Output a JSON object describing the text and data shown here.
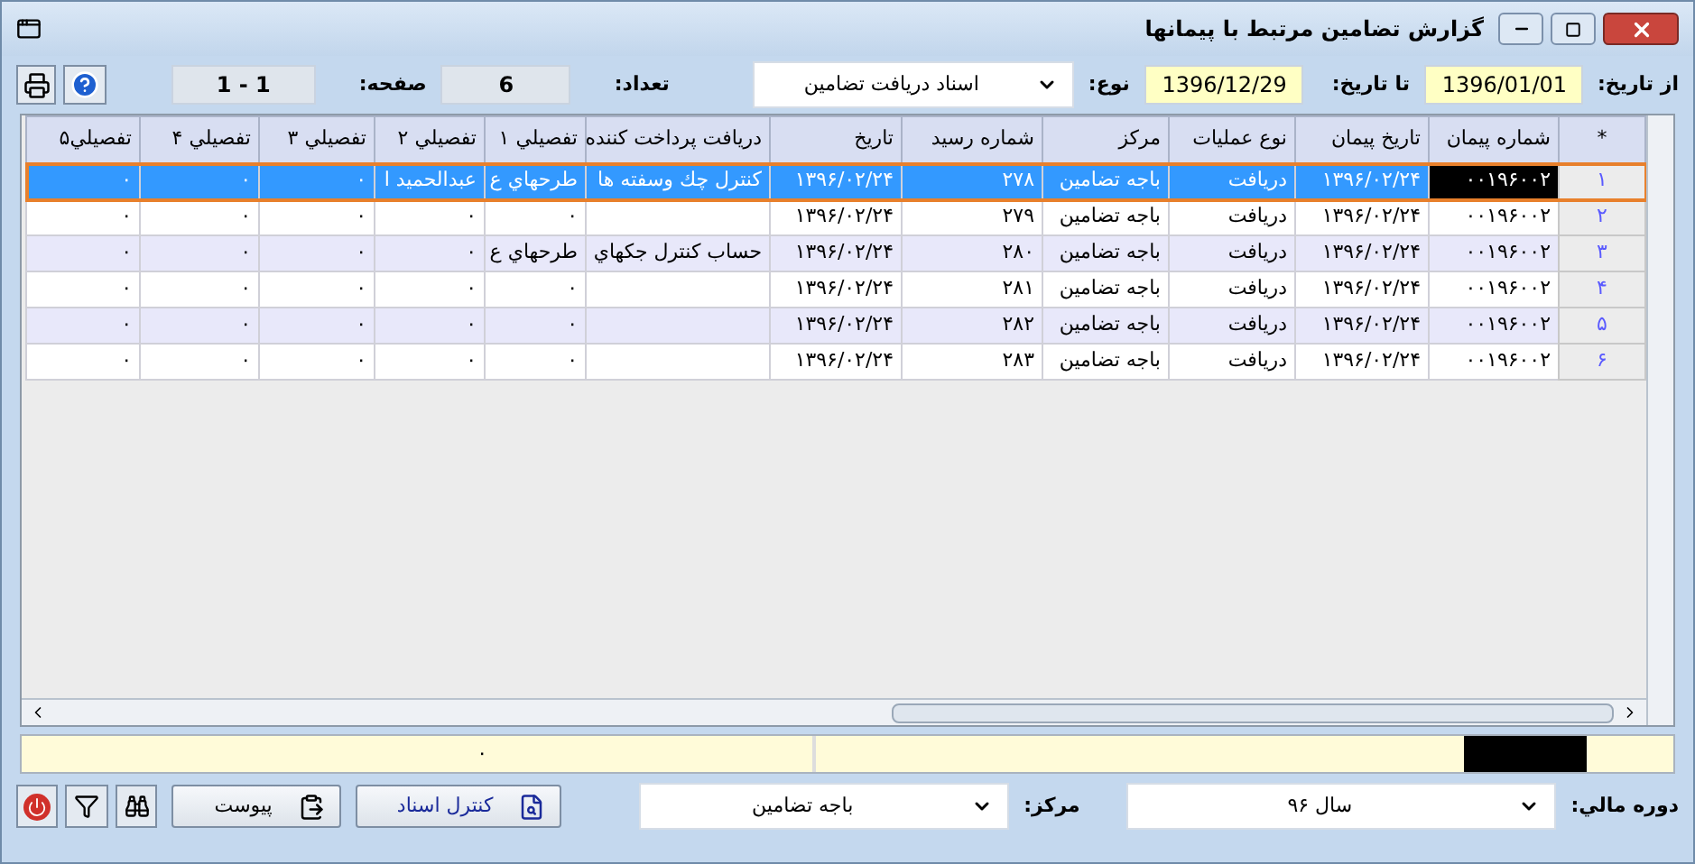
{
  "window": {
    "title": "گزارش تضامين مرتبط با پيمانها"
  },
  "filters": {
    "from_label": "از تاريخ:",
    "from_value": "1396/01/01",
    "to_label": "تا تاريخ:",
    "to_value": "1396/12/29",
    "type_label": "نوع:",
    "type_value": "اسناد دريافت تضامين",
    "count_label": "تعداد:",
    "count_value": "6",
    "page_label": "صفحه:",
    "page_value": "1 - 1"
  },
  "table": {
    "corner": "*",
    "columns": [
      "شماره پيمان",
      "تاريخ پيمان",
      "نوع عمليات",
      "مرکز",
      "شماره رسيد",
      "تاريخ",
      "دريافت پرداخت کننده",
      "تفصيلي ۱",
      "تفصيلي ۲",
      "تفصيلي ۳",
      "تفصيلي ۴",
      "تفصيلي۵"
    ],
    "rows": [
      {
        "number": "۱",
        "selected": true,
        "cells": [
          "۰۰۱۹۶۰۰۲",
          "۱۳۹۶/۰۲/۲۴",
          "دريافت",
          "باجه تضامين",
          "۲۷۸",
          "۱۳۹۶/۰۲/۲۴",
          "کنترل چك وسفته ها",
          "طرحهاي ع",
          "عبدالحميد ا",
          "۰",
          "۰",
          "۰"
        ]
      },
      {
        "number": "۲",
        "selected": false,
        "cells": [
          "۰۰۱۹۶۰۰۲",
          "۱۳۹۶/۰۲/۲۴",
          "دريافت",
          "باجه تضامين",
          "۲۷۹",
          "۱۳۹۶/۰۲/۲۴",
          "",
          "۰",
          "۰",
          "۰",
          "۰",
          "۰"
        ]
      },
      {
        "number": "۳",
        "selected": false,
        "cells": [
          "۰۰۱۹۶۰۰۲",
          "۱۳۹۶/۰۲/۲۴",
          "دريافت",
          "باجه تضامين",
          "۲۸۰",
          "۱۳۹۶/۰۲/۲۴",
          "حساب کنترل جکهاي",
          "طرحهاي ع",
          "۰",
          "۰",
          "۰",
          "۰"
        ]
      },
      {
        "number": "۴",
        "selected": false,
        "cells": [
          "۰۰۱۹۶۰۰۲",
          "۱۳۹۶/۰۲/۲۴",
          "دريافت",
          "باجه تضامين",
          "۲۸۱",
          "۱۳۹۶/۰۲/۲۴",
          "",
          "۰",
          "۰",
          "۰",
          "۰",
          "۰"
        ]
      },
      {
        "number": "۵",
        "selected": false,
        "cells": [
          "۰۰۱۹۶۰۰۲",
          "۱۳۹۶/۰۲/۲۴",
          "دريافت",
          "باجه تضامين",
          "۲۸۲",
          "۱۳۹۶/۰۲/۲۴",
          "",
          "۰",
          "۰",
          "۰",
          "۰",
          "۰"
        ]
      },
      {
        "number": "۶",
        "selected": false,
        "cells": [
          "۰۰۱۹۶۰۰۲",
          "۱۳۹۶/۰۲/۲۴",
          "دريافت",
          "باجه تضامين",
          "۲۸۳",
          "۱۳۹۶/۰۲/۲۴",
          "",
          "۰",
          "۰",
          "۰",
          "۰",
          "۰"
        ]
      }
    ]
  },
  "summary": {
    "value": "۰"
  },
  "bottom": {
    "fiscal_label": "دوره مالي:",
    "fiscal_value": "سال ۹۶",
    "center_label": "مرکز:",
    "center_value": "باجه تضامين",
    "buttons": [
      {
        "label": "کنترل اسناد",
        "kind": "preview"
      },
      {
        "label": "پيوست",
        "kind": "attach"
      }
    ]
  }
}
